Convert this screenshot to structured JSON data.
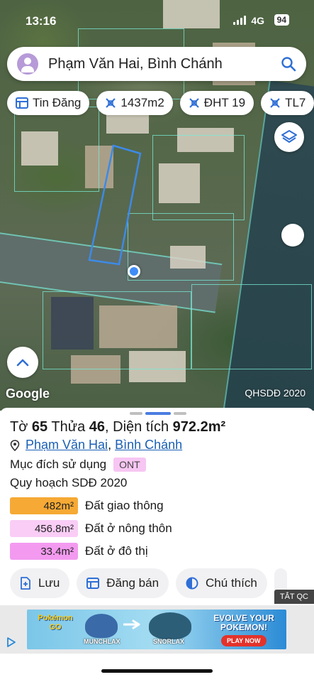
{
  "status_bar": {
    "time": "13:16",
    "network": "4G",
    "battery": "94"
  },
  "search": {
    "text": "Phạm Văn Hai, Bình Chánh"
  },
  "chips": [
    {
      "label": "Tin Đăng",
      "icon": "list-icon"
    },
    {
      "label": "1437m2",
      "icon": "pattern-icon"
    },
    {
      "label": "ĐHT 19",
      "icon": "pattern-icon"
    },
    {
      "label": "TL7",
      "icon": "pattern-icon"
    }
  ],
  "map": {
    "attribution": "Google",
    "layer_label": "QHSDĐ 2020"
  },
  "parcel": {
    "title_to": "Tờ",
    "to_value": "65",
    "thua_label": "Thửa",
    "thua_value": "46",
    "area_label": "Diện tích",
    "area_value": "972.2m²",
    "street": "Phạm Văn Hai",
    "district": "Bình Chánh",
    "purpose_label": "Mục đích sử dụng",
    "purpose_badge": "ONT",
    "plan_label": "Quy hoạch SDĐ 2020",
    "zones": [
      {
        "area": "482m²",
        "label": "Đất giao thông",
        "color": "#f6a934"
      },
      {
        "area": "456.8m²",
        "label": "Đất ở nông thôn",
        "color": "#f9cdf5"
      },
      {
        "area": "33.4m²",
        "label": "Đất ở đô thị",
        "color": "#f39af0"
      }
    ]
  },
  "actions": {
    "save": "Lưu",
    "post": "Đăng bán",
    "legend": "Chú thích"
  },
  "ad": {
    "close_label": "TẮT QC",
    "logo_line1": "Pokémon",
    "logo_line2": "GO",
    "left_name": "MUNCHLAX",
    "right_name": "SNORLAX",
    "headline": "EVOLVE YOUR POKEMON!",
    "cta": "PLAY NOW"
  },
  "colors": {
    "accent": "#1a5fb4",
    "dot": "#3f8cf7",
    "parcel_outline": "#3d8ae8"
  }
}
